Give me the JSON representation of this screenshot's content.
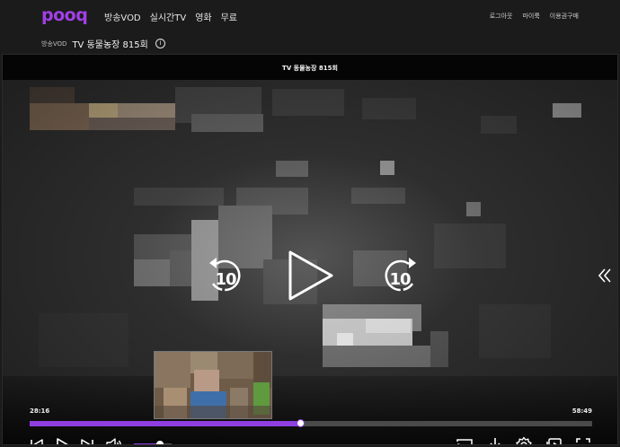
{
  "logo": {
    "text": "pooq"
  },
  "nav": {
    "main": [
      "방송VOD",
      "실시간TV",
      "영화",
      "무료"
    ],
    "user": [
      "로그아웃",
      "마이룩",
      "이용권구매"
    ]
  },
  "breadcrumb": {
    "category": "방송VOD",
    "title": "TV 동물농장 815회"
  },
  "player": {
    "title": "TV 동물농장 815회",
    "rewind_seconds": "10",
    "forward_seconds": "10",
    "current_time": "28:16",
    "duration": "58:49",
    "progress_fraction": 0.481,
    "volume_fraction": 0.68
  },
  "icons": {
    "info": "info-icon",
    "rewind": "rewind-10-icon",
    "play": "play-icon",
    "forward": "forward-10-icon",
    "side_panel": "double-chevron-left-icon",
    "skip_prev": "skip-previous-icon",
    "play_small": "play-icon",
    "skip_next": "skip-next-icon",
    "volume": "volume-icon",
    "cast": "cast-icon",
    "download": "download-icon",
    "settings": "gear-icon",
    "playlist": "playlist-icon",
    "fullscreen": "fullscreen-icon"
  },
  "colors": {
    "accent": "#8f3ee0",
    "logo": "#a13fe8",
    "background": "#1b1b1b"
  }
}
